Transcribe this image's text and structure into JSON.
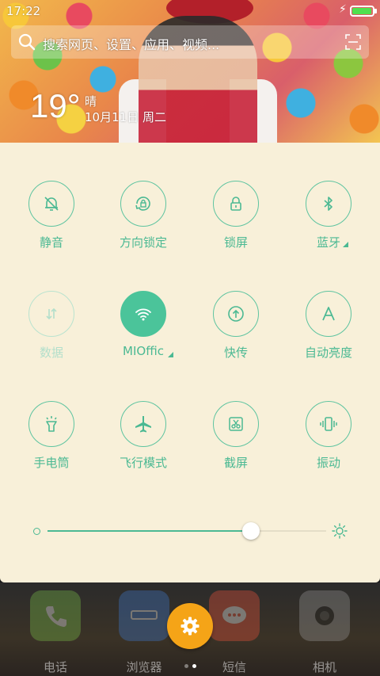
{
  "status_bar": {
    "time": "17:22",
    "battery_percent": 95,
    "charging": true
  },
  "search": {
    "placeholder": "搜索网页、设置、应用、视频..."
  },
  "weather": {
    "temperature": "19°",
    "condition": "晴",
    "date": "10月11日 周二"
  },
  "toggles": [
    {
      "id": "mute",
      "label": "静音",
      "icon": "bell-off-icon",
      "state": "off"
    },
    {
      "id": "rotation-lock",
      "label": "方向锁定",
      "icon": "rotation-lock-icon",
      "state": "off"
    },
    {
      "id": "lock-screen",
      "label": "锁屏",
      "icon": "lock-icon",
      "state": "off"
    },
    {
      "id": "bluetooth",
      "label": "蓝牙",
      "icon": "bluetooth-icon",
      "state": "off",
      "has_menu": true
    },
    {
      "id": "data",
      "label": "数据",
      "icon": "data-arrows-icon",
      "state": "disabled"
    },
    {
      "id": "wifi",
      "label": "MIOffic",
      "icon": "wifi-icon",
      "state": "on",
      "has_menu": true
    },
    {
      "id": "quick-share",
      "label": "快传",
      "icon": "upload-circle-icon",
      "state": "off"
    },
    {
      "id": "auto-brightness",
      "label": "自动亮度",
      "icon": "letter-a-icon",
      "state": "off"
    },
    {
      "id": "flashlight",
      "label": "手电筒",
      "icon": "flashlight-icon",
      "state": "off"
    },
    {
      "id": "airplane",
      "label": "飞行模式",
      "icon": "airplane-icon",
      "state": "off"
    },
    {
      "id": "screenshot",
      "label": "截屏",
      "icon": "scissors-icon",
      "state": "off"
    },
    {
      "id": "vibrate",
      "label": "振动",
      "icon": "vibrate-icon",
      "state": "off"
    }
  ],
  "brightness": {
    "level": 0.73
  },
  "dock": {
    "apps": [
      {
        "label": "电话",
        "icon": "phone-icon",
        "color": "#7cc24a"
      },
      {
        "label": "浏览器",
        "icon": "browser-icon",
        "color": "#3e7ad1"
      },
      {
        "label": "短信",
        "icon": "message-icon",
        "color": "#f0543c"
      },
      {
        "label": "相机",
        "icon": "camera-icon",
        "color": "#9b9b9b"
      }
    ],
    "settings_button": "gear-icon",
    "page_count": 2,
    "current_page": 2
  },
  "colors": {
    "accent": "#4bc49a",
    "panel_bg": "#f8f0d9",
    "fab": "#f5a417"
  }
}
